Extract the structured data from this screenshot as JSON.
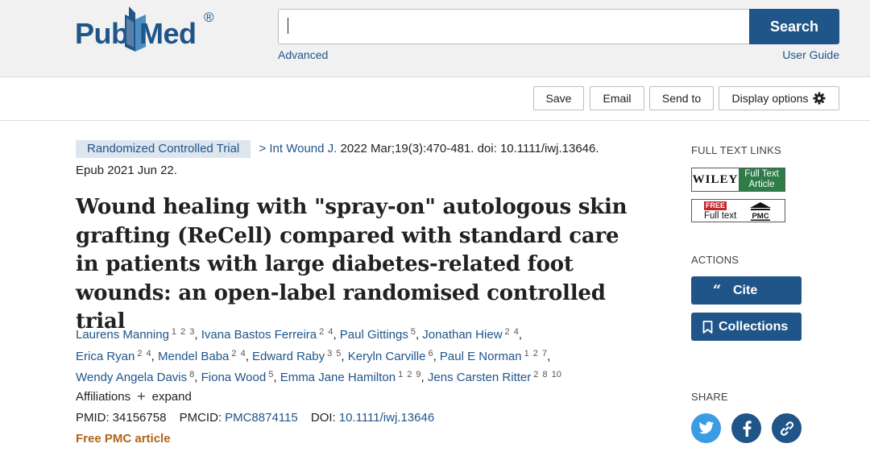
{
  "header": {
    "logo_pub": "Pub",
    "logo_med": "Med",
    "logo_reg": "®",
    "search_value": "",
    "search_button": "Search",
    "advanced_link": "Advanced",
    "user_guide_link": "User Guide"
  },
  "toolbar": {
    "save": "Save",
    "email": "Email",
    "send_to": "Send to",
    "display_options": "Display options"
  },
  "article": {
    "type_badge": "Randomized Controlled Trial",
    "journal_chevron": ">",
    "journal": "Int Wound J.",
    "citation": "2022 Mar;19(3):470-481. doi: 10.1111/iwj.13646.",
    "epub": "Epub 2021 Jun 22.",
    "title": "Wound healing with \"spray-on\" autologous skin grafting (ReCell) compared with standard care in patients with large diabetes-related foot wounds: an open-label randomised controlled trial",
    "authors": [
      {
        "name": "Laurens Manning",
        "aff": "1 2 3"
      },
      {
        "name": "Ivana Bastos Ferreira",
        "aff": "2 4"
      },
      {
        "name": "Paul Gittings",
        "aff": "5"
      },
      {
        "name": "Jonathan Hiew",
        "aff": "2 4"
      },
      {
        "name": "Erica Ryan",
        "aff": "2 4"
      },
      {
        "name": "Mendel Baba",
        "aff": "2 4"
      },
      {
        "name": "Edward Raby",
        "aff": "3 5"
      },
      {
        "name": "Keryln Carville",
        "aff": "6"
      },
      {
        "name": "Paul E Norman",
        "aff": "1 2 7"
      },
      {
        "name": "Wendy Angela Davis",
        "aff": "8"
      },
      {
        "name": "Fiona Wood",
        "aff": "5"
      },
      {
        "name": "Emma Jane Hamilton",
        "aff": "1 2 9"
      },
      {
        "name": "Jens Carsten Ritter",
        "aff": "2 8 10"
      }
    ],
    "affiliations_label": "Affiliations",
    "expand_label": "expand",
    "pmid_label": "PMID:",
    "pmid": "34156758",
    "pmcid_label": "PMCID:",
    "pmcid": "PMC8874115",
    "doi_label": "DOI:",
    "doi": "10.1111/iwj.13646",
    "free_pmc": "Free PMC article"
  },
  "sidebar": {
    "full_text_links_heading": "FULL TEXT LINKS",
    "wiley_label": "WILEY",
    "wiley_full_text_line1": "Full Text",
    "wiley_full_text_line2": "Article",
    "pmc_free": "FREE",
    "pmc_full_text": "Full text",
    "pmc_label": "PMC",
    "actions_heading": "ACTIONS",
    "cite_button": "Cite",
    "collections_button": "Collections",
    "share_heading": "SHARE"
  },
  "colors": {
    "brand_blue": "#20558a",
    "header_bg": "#f1f1f1",
    "badge_bg": "#dde5ef",
    "free_pmc_orange": "#b0641a",
    "wiley_green": "#2e7d49",
    "twitter_blue": "#3b9be3"
  },
  "icons": [
    "pubmed-book-icon",
    "gear-icon",
    "quote-icon",
    "bookmark-icon",
    "twitter-icon",
    "facebook-icon",
    "link-icon",
    "pmc-building-icon"
  ]
}
